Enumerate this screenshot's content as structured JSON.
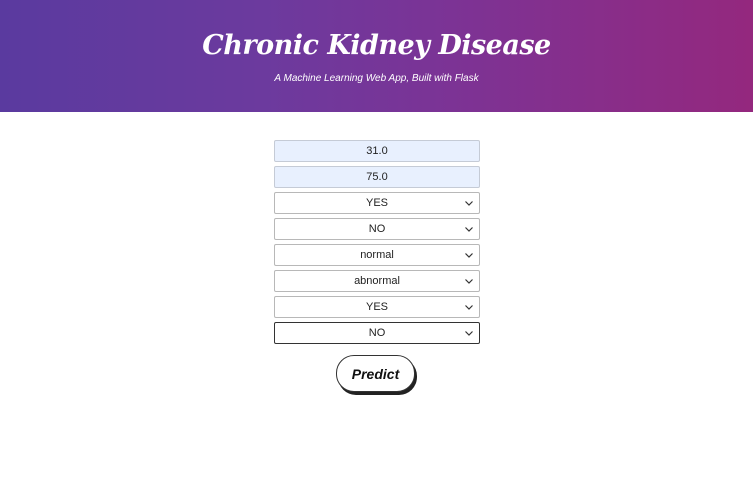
{
  "header": {
    "title": "Chronic Kidney Disease",
    "subtitle": "A Machine Learning Web App, Built with Flask"
  },
  "form": {
    "fields": [
      {
        "type": "input",
        "value": "31.0"
      },
      {
        "type": "input",
        "value": "75.0"
      },
      {
        "type": "select",
        "value": "YES"
      },
      {
        "type": "select",
        "value": "NO"
      },
      {
        "type": "select",
        "value": "normal"
      },
      {
        "type": "select",
        "value": "abnormal"
      },
      {
        "type": "select",
        "value": "YES"
      },
      {
        "type": "select",
        "value": "NO",
        "focused": true
      }
    ],
    "submit_label": "Predict"
  },
  "colors": {
    "header_gradient_start": "#5a3a9f",
    "header_gradient_end": "#94287e",
    "autofill_bg": "#e8f0fe"
  },
  "icons": {
    "select_arrow": "chevron-down-icon"
  }
}
